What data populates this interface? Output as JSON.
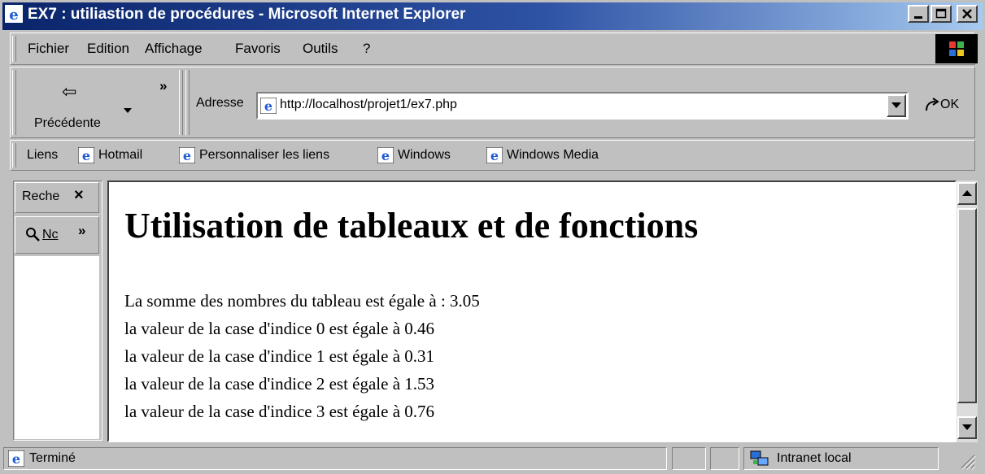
{
  "window": {
    "title": "EX7 : utiliastion de procédures - Microsoft Internet Explorer",
    "controls": {
      "minimize": "_",
      "maximize": "□",
      "close": "×"
    }
  },
  "menu": [
    "Fichier",
    "Edition",
    "Affichage",
    "Favoris",
    "Outils",
    "?"
  ],
  "toolbar": {
    "back_label": "Précédente",
    "back_arrow": "⇦",
    "more": "»",
    "address_label": "Adresse",
    "address_value": "http://localhost/projet1/ex7.php",
    "go_label": "OK"
  },
  "links": {
    "label": "Liens",
    "items": [
      "Hotmail",
      "Personnaliser les liens",
      "Windows",
      "Windows Media"
    ]
  },
  "explorer_bar": {
    "search_label": "Reche",
    "close": "×",
    "new_label": "Nc",
    "more": "»"
  },
  "page": {
    "title": "Utilisation de tableaux et de fonctions",
    "lines": [
      "La somme des nombres du tableau est égale à : 3.05",
      "la valeur de la case d'indice 0 est égale à 0.46",
      "la valeur de la case d'indice 1 est égale à 0.31",
      "la valeur de la case d'indice 2 est égale à 1.53",
      "la valeur de la case d'indice 3 est égale à 0.76"
    ]
  },
  "status": {
    "text": "Terminé",
    "zone": "Intranet local"
  },
  "icons": {
    "ie": "ie-logo-icon",
    "windows": "windows-logo-icon",
    "intranet": "intranet-zone-icon"
  },
  "colors": {
    "title_gradient_start": "#0a246a",
    "title_gradient_end": "#a6caf0",
    "chrome": "#c0c0c0"
  }
}
